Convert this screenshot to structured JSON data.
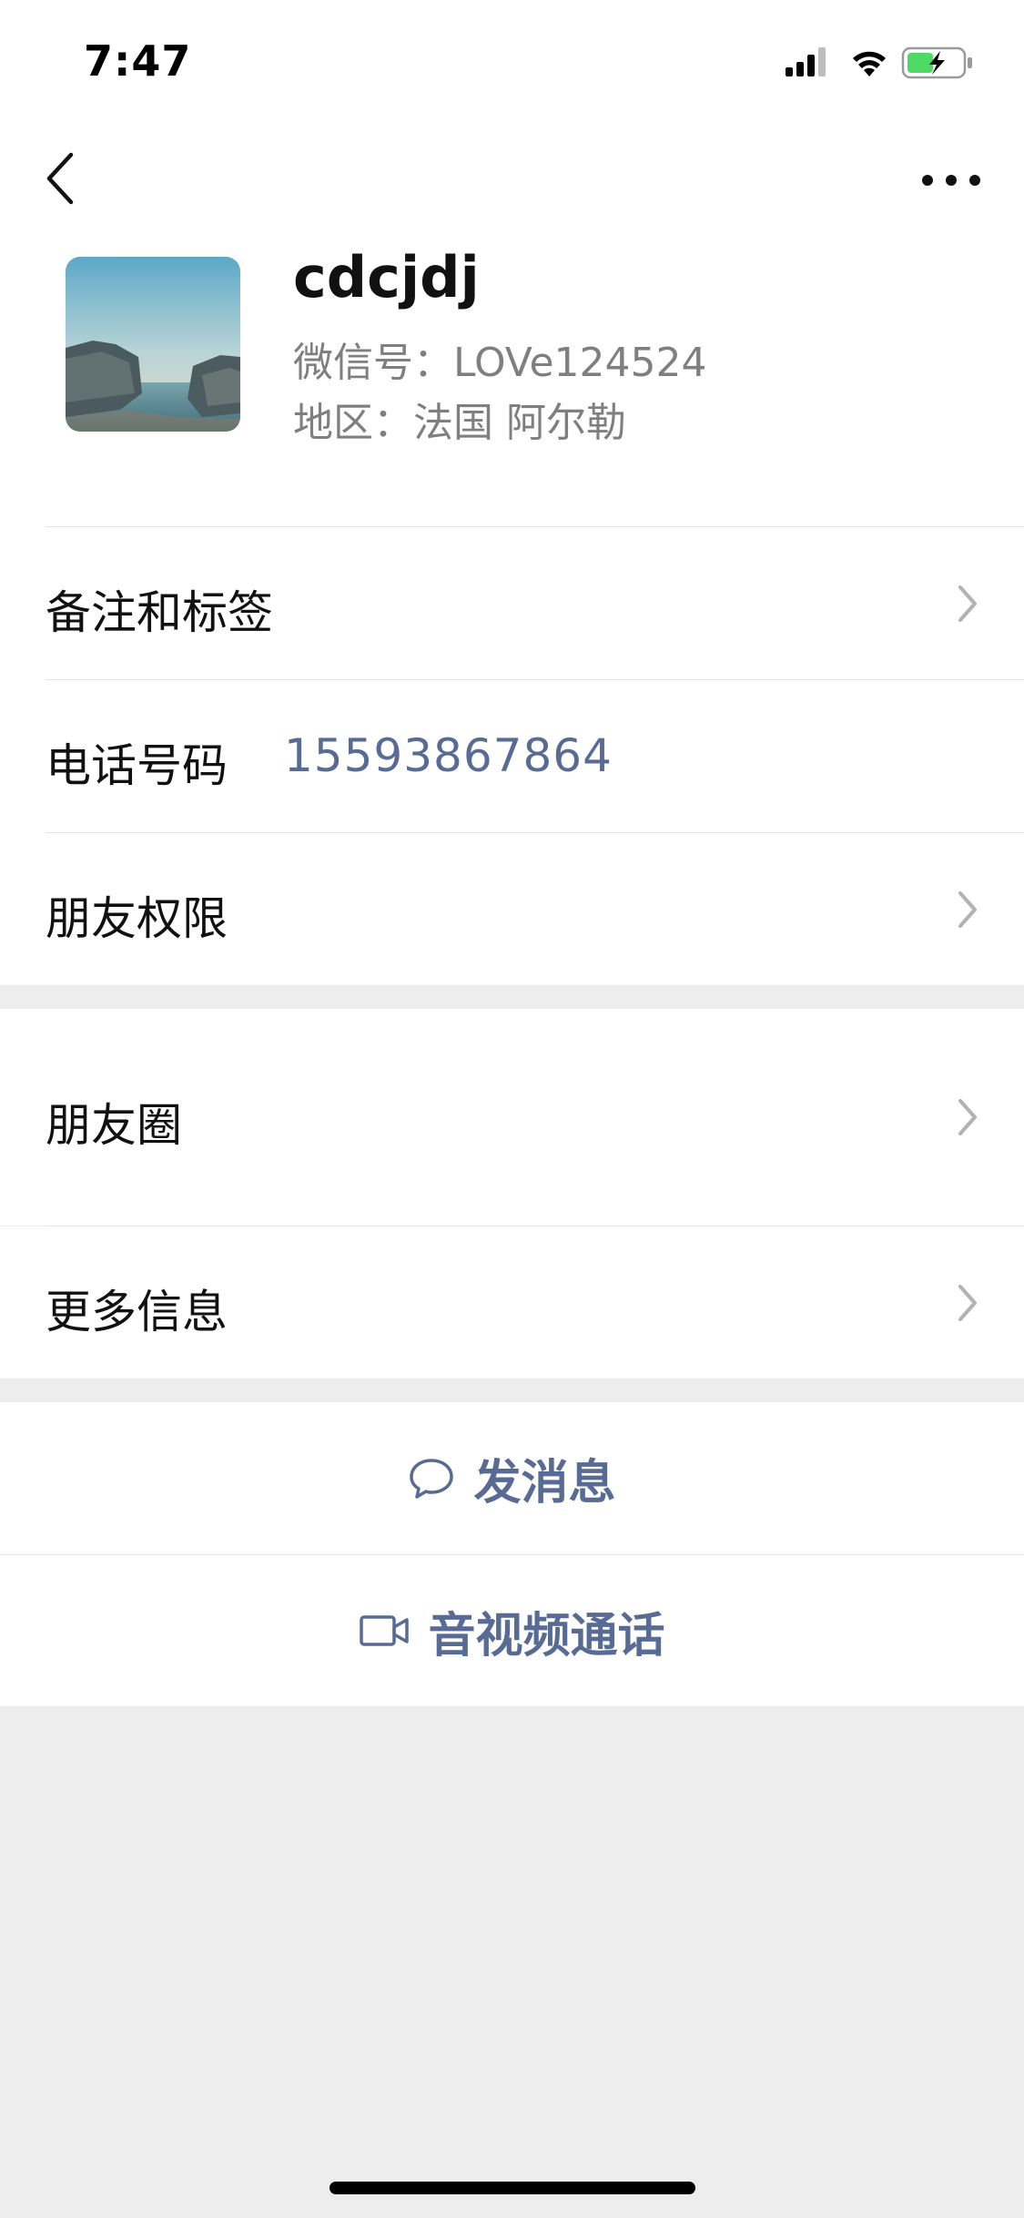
{
  "status_bar": {
    "time": "7:47"
  },
  "profile": {
    "name": "cdcjdj",
    "wechat_id": "微信号：LOVe124524",
    "region": "地区：法国 阿尔勒"
  },
  "list": {
    "notes_tags": "备注和标签",
    "phone_label": "电话号码",
    "phone_value": "15593867864",
    "friend_permissions": "朋友权限",
    "moments": "朋友圈",
    "more_info": "更多信息"
  },
  "actions": {
    "send_message": "发消息",
    "av_call": "音视频通话"
  },
  "colors": {
    "link": "#576b95",
    "background": "#ededed",
    "battery_green": "#4cd964"
  }
}
